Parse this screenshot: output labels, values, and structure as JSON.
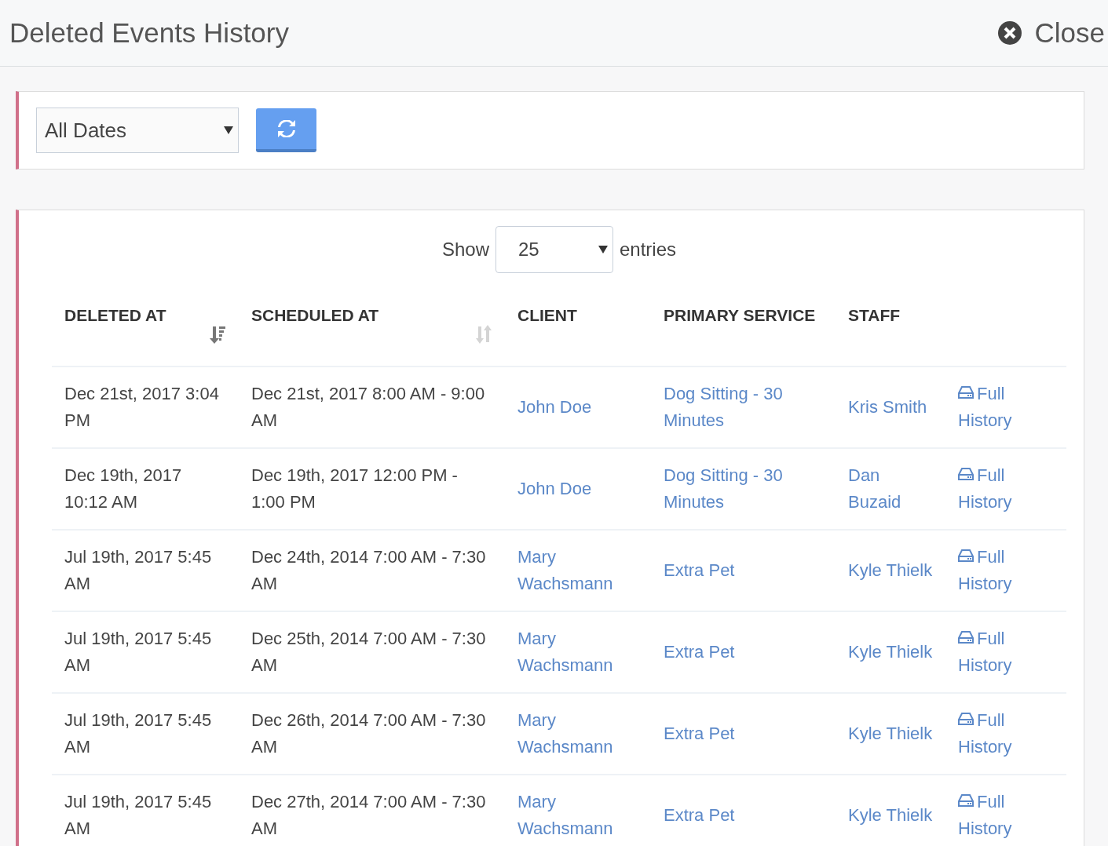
{
  "header": {
    "title": "Deleted Events History",
    "close_label": "Close"
  },
  "filter": {
    "date_range": "All Dates"
  },
  "table": {
    "show_label": "Show",
    "page_size": "25",
    "entries_label": "entries",
    "columns": [
      {
        "label": "DELETED AT",
        "sorted": true
      },
      {
        "label": "SCHEDULED AT",
        "sorted": false
      },
      {
        "label": "CLIENT"
      },
      {
        "label": "PRIMARY SERVICE"
      },
      {
        "label": "STAFF"
      }
    ],
    "rows": [
      {
        "deleted_at": "Dec 21st, 2017 3:04 PM",
        "scheduled_at": "Dec 21st, 2017 8:00 AM - 9:00 AM",
        "client": "John Doe",
        "primary_service": "Dog Sitting - 30 Minutes",
        "staff": "Kris Smith",
        "action": "Full History"
      },
      {
        "deleted_at": "Dec 19th, 2017 10:12 AM",
        "scheduled_at": "Dec 19th, 2017 12:00 PM - 1:00 PM",
        "client": "John Doe",
        "primary_service": "Dog Sitting - 30 Minutes",
        "staff": "Dan Buzaid",
        "action": "Full History"
      },
      {
        "deleted_at": "Jul 19th, 2017 5:45 AM",
        "scheduled_at": "Dec 24th, 2014 7:00 AM - 7:30 AM",
        "client": "Mary Wachsmann",
        "primary_service": "Extra Pet",
        "staff": "Kyle Thielk",
        "action": "Full History"
      },
      {
        "deleted_at": "Jul 19th, 2017 5:45 AM",
        "scheduled_at": "Dec 25th, 2014 7:00 AM - 7:30 AM",
        "client": "Mary Wachsmann",
        "primary_service": "Extra Pet",
        "staff": "Kyle Thielk",
        "action": "Full History"
      },
      {
        "deleted_at": "Jul 19th, 2017 5:45 AM",
        "scheduled_at": "Dec 26th, 2014 7:00 AM - 7:30 AM",
        "client": "Mary Wachsmann",
        "primary_service": "Extra Pet",
        "staff": "Kyle Thielk",
        "action": "Full History"
      },
      {
        "deleted_at": "Jul 19th, 2017 5:45 AM",
        "scheduled_at": "Dec 27th, 2014 7:00 AM - 7:30 AM",
        "client": "Mary Wachsmann",
        "primary_service": "Extra Pet",
        "staff": "Kyle Thielk",
        "action": "Full History"
      }
    ]
  }
}
